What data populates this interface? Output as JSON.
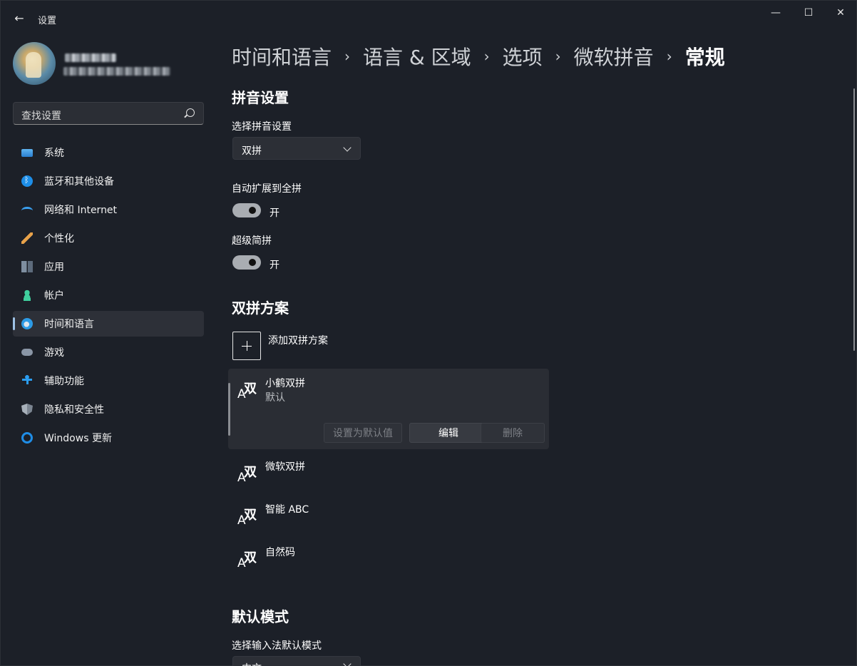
{
  "app": {
    "title": "设置",
    "back_glyph": "←"
  },
  "window_controls": {
    "minimize": "—",
    "maximize": "☐",
    "close": "✕"
  },
  "search": {
    "placeholder": "查找设置"
  },
  "nav": [
    {
      "label": "系统",
      "icon": "system-icon"
    },
    {
      "label": "蓝牙和其他设备",
      "icon": "bluetooth-icon"
    },
    {
      "label": "网络和 Internet",
      "icon": "wifi-icon"
    },
    {
      "label": "个性化",
      "icon": "brush-icon"
    },
    {
      "label": "应用",
      "icon": "apps-icon"
    },
    {
      "label": "帐户",
      "icon": "account-icon"
    },
    {
      "label": "时间和语言",
      "icon": "time-language-icon",
      "active": true
    },
    {
      "label": "游戏",
      "icon": "gamepad-icon"
    },
    {
      "label": "辅助功能",
      "icon": "accessibility-icon"
    },
    {
      "label": "隐私和安全性",
      "icon": "shield-icon"
    },
    {
      "label": "Windows 更新",
      "icon": "update-icon"
    }
  ],
  "breadcrumb": [
    "时间和语言",
    "语言 & 区域",
    "选项",
    "微软拼音"
  ],
  "breadcrumb_current": "常规",
  "breadcrumb_sep": "›",
  "pinyin": {
    "section_title": "拼音设置",
    "select_label": "选择拼音设置",
    "select_value": "双拼",
    "auto_expand_label": "自动扩展到全拼",
    "auto_expand_state": "开",
    "super_jianpin_label": "超级简拼",
    "super_jianpin_state": "开"
  },
  "shuangpin": {
    "section_title": "双拼方案",
    "add_label": "添加双拼方案",
    "icon_glyph_a": "A",
    "icon_glyph_shuang": "双",
    "schemes": [
      {
        "name": "小鹤双拼",
        "sub": "默认"
      },
      {
        "name": "微软双拼"
      },
      {
        "name": "智能 ABC"
      },
      {
        "name": "自然码"
      }
    ],
    "buttons": {
      "set_default": "设置为默认值",
      "edit": "编辑",
      "delete": "删除"
    }
  },
  "default_mode": {
    "section_title": "默认模式",
    "select_label": "选择输入法默认模式",
    "select_value": "中文"
  },
  "colors": {
    "background": "#1c2028",
    "accent": "#9ec2e6",
    "card": "#2a2d34"
  }
}
